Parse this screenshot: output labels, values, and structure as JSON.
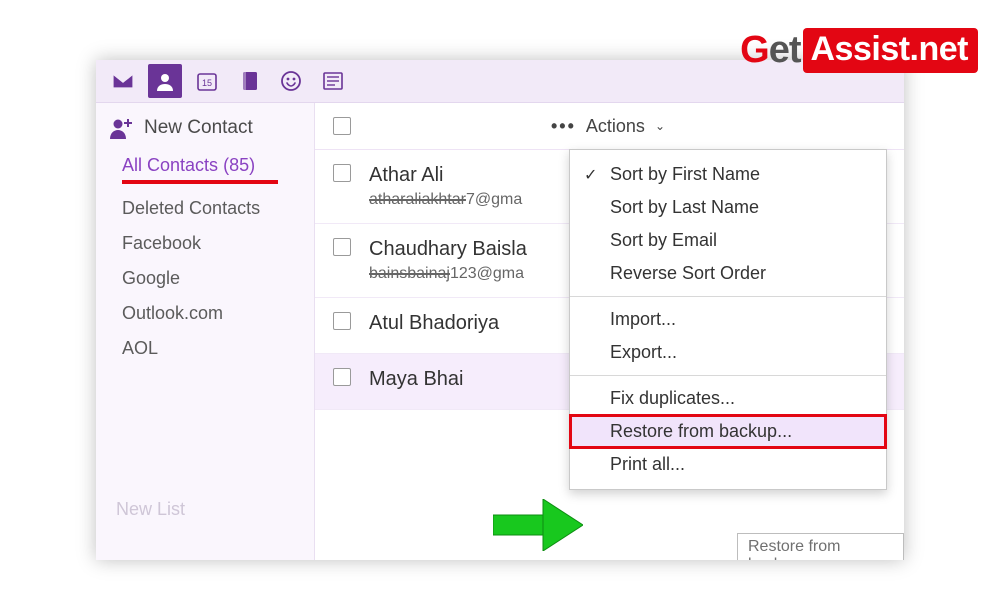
{
  "watermark": {
    "g": "G",
    "et": "et",
    "badge": "Assist.net"
  },
  "nav_icons": [
    "mail",
    "contacts",
    "calendar",
    "notes",
    "emoji",
    "news"
  ],
  "sidebar": {
    "new_contact_label": "New Contact",
    "items": [
      {
        "label": "All Contacts",
        "count": 85,
        "active": true
      },
      {
        "label": "Deleted Contacts"
      },
      {
        "label": "Facebook"
      },
      {
        "label": "Google"
      },
      {
        "label": "Outlook.com"
      },
      {
        "label": "AOL"
      }
    ],
    "new_list_label": "New List"
  },
  "main": {
    "actions_label": "Actions",
    "contacts": [
      {
        "name": "Athar Ali",
        "email_hidden": "atharaliakhtar",
        "email_tail": "7@gma"
      },
      {
        "name": "Chaudhary Baisla",
        "email_hidden": "bainsbainaj",
        "email_tail": "123@gma"
      },
      {
        "name": "Atul Bhadoriya",
        "email_hidden": "",
        "email_tail": ""
      },
      {
        "name": "Maya Bhai",
        "email_hidden": "",
        "email_tail": "",
        "highlight": true
      }
    ]
  },
  "menu": {
    "sections": [
      [
        {
          "label": "Sort by First Name",
          "checked": true
        },
        {
          "label": "Sort by Last Name"
        },
        {
          "label": "Sort by Email"
        },
        {
          "label": "Reverse Sort Order"
        }
      ],
      [
        {
          "label": "Import..."
        },
        {
          "label": "Export..."
        }
      ],
      [
        {
          "label": "Fix duplicates..."
        },
        {
          "label": "Restore from backup...",
          "highlight": true,
          "boxed": true
        },
        {
          "label": "Print all..."
        }
      ]
    ]
  },
  "tooltip": "Restore from backup"
}
